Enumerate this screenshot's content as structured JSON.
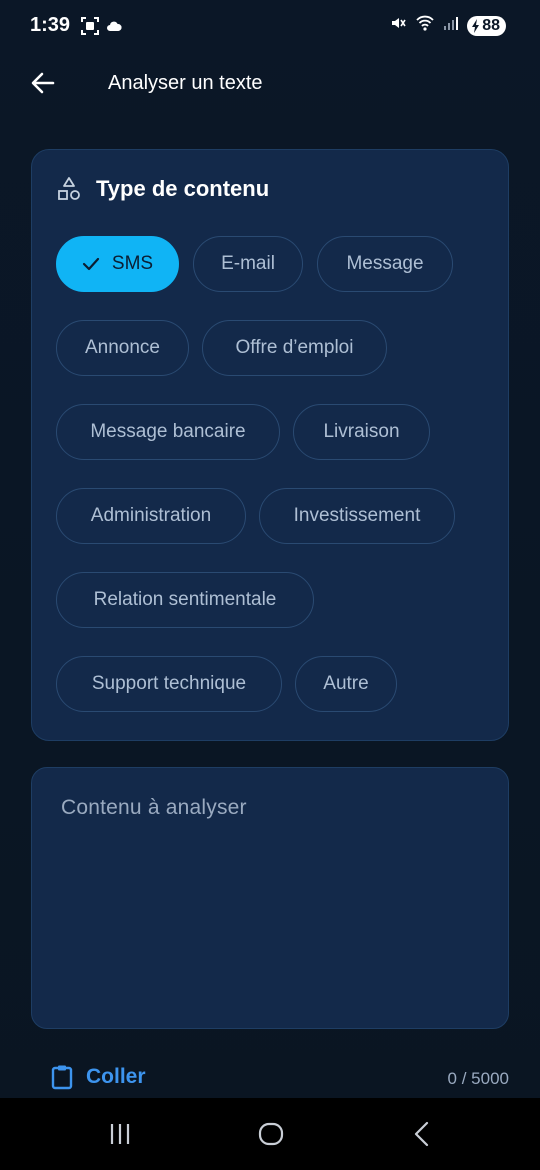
{
  "status_bar": {
    "time": "1:39",
    "battery": "88"
  },
  "app_bar": {
    "title": "Analyser un texte"
  },
  "content_type": {
    "title": "Type de contenu",
    "chips": [
      {
        "label": "SMS",
        "selected": true
      },
      {
        "label": "E-mail",
        "selected": false
      },
      {
        "label": "Message",
        "selected": false
      },
      {
        "label": "Annonce",
        "selected": false
      },
      {
        "label": "Offre d’emploi",
        "selected": false
      },
      {
        "label": "Message bancaire",
        "selected": false
      },
      {
        "label": "Livraison",
        "selected": false
      },
      {
        "label": "Administration",
        "selected": false
      },
      {
        "label": "Investissement",
        "selected": false
      },
      {
        "label": "Relation sentimentale",
        "selected": false
      },
      {
        "label": "Support technique",
        "selected": false
      },
      {
        "label": "Autre",
        "selected": false
      }
    ]
  },
  "input": {
    "placeholder": "Contenu à analyser"
  },
  "actions": {
    "paste_label": "Coller",
    "counter": "0 / 5000"
  },
  "colors": {
    "accent": "#10b4f5",
    "link": "#3d94ee",
    "card": "#13294a",
    "background": "#0b1727"
  }
}
